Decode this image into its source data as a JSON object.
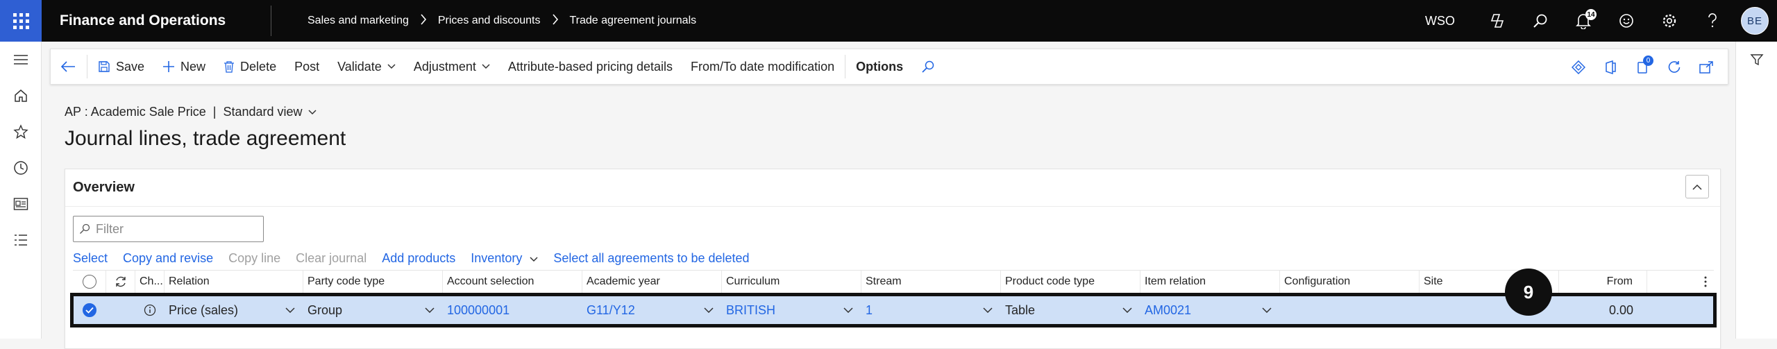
{
  "topbar": {
    "app_name": "Finance and Operations",
    "breadcrumbs": [
      "Sales and marketing",
      "Prices and discounts",
      "Trade agreement journals"
    ],
    "company": "WSO",
    "notifications_count": "14",
    "user_initials": "BE"
  },
  "actions": {
    "save": "Save",
    "new": "New",
    "delete": "Delete",
    "post": "Post",
    "validate": "Validate",
    "adjustment": "Adjustment",
    "attribute_pricing": "Attribute-based pricing details",
    "from_to_date": "From/To date modification",
    "options": "Options",
    "attach_count": "0"
  },
  "header": {
    "record": "AP : Academic Sale Price",
    "pipe": "|",
    "view": "Standard view",
    "title": "Journal lines, trade agreement"
  },
  "overview": {
    "title": "Overview",
    "filter_placeholder": "Filter",
    "grid_actions": [
      "Select",
      "Copy and revise",
      "Copy line",
      "Clear journal",
      "Add products",
      "Inventory",
      "Select all agreements to be deleted"
    ],
    "columns": [
      "Ch...",
      "Relation",
      "Party code type",
      "Account selection",
      "Academic year",
      "Curriculum",
      "Stream",
      "Product code type",
      "Item relation",
      "Configuration",
      "Site",
      "From"
    ],
    "row": {
      "relation": "Price (sales)",
      "party_code_type": "Group",
      "account_selection": "100000001",
      "academic_year": "G11/Y12",
      "curriculum": "BRITISH",
      "stream": "1",
      "product_code_type": "Table",
      "item_relation": "AM0021",
      "configuration": "",
      "site": "",
      "from": "0.00"
    }
  },
  "callout": "9",
  "colors": {
    "accent": "#2266e3",
    "topbar": "#0b0b0b",
    "waffle": "#2f5fd3",
    "selected_row": "#cfe0f7"
  }
}
